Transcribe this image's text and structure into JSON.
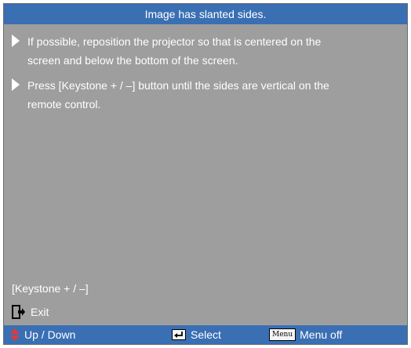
{
  "title": "Image has slanted sides.",
  "bullets": [
    {
      "line1": "If possible, reposition the projector so that is centered on the",
      "line2": "screen and below the bottom of the screen."
    },
    {
      "line1": "Press [Keystone + / –] button until the sides are vertical on the",
      "line2": "remote control."
    }
  ],
  "keystone_label": "[Keystone + / –]",
  "exit_label": "Exit",
  "footer": {
    "updown_label": "Up / Down",
    "select_label": "Select",
    "menu_key": "Menu",
    "menuoff_label": "Menu off"
  },
  "colors": {
    "bar": "#3a6fb4",
    "panel": "#9e9e9e",
    "arrow": "#e03a3a"
  },
  "icons": {
    "bullet": "triangle-right-icon",
    "exit": "exit-door-icon",
    "updown": "up-down-arrow-icon",
    "select": "enter-key-icon"
  }
}
